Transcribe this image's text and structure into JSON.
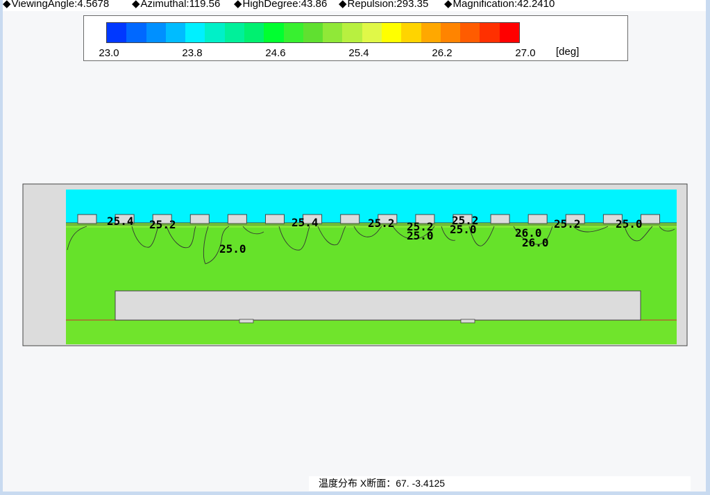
{
  "header": {
    "params": [
      {
        "label": "ViewingAngle",
        "value": ":4.5678"
      },
      {
        "label": "Azimuthal",
        "value": ":119.56"
      },
      {
        "label": "HighDegree",
        "value": ":43.86"
      },
      {
        "label": "Repulsion",
        "value": ":293.35"
      },
      {
        "label": "Magnification",
        "value": ":42.2410"
      }
    ]
  },
  "legend": {
    "ticks": [
      "23.0",
      "23.8",
      "24.6",
      "25.4",
      "26.2",
      "27.0"
    ],
    "unit": "[deg]",
    "colors": [
      "#0038ff",
      "#0068ff",
      "#0090ff",
      "#00bcff",
      "#00f0ff",
      "#00f0c8",
      "#00f09a",
      "#00f070",
      "#00ff30",
      "#38f030",
      "#60e030",
      "#90e838",
      "#b8f040",
      "#e0f848",
      "#ffff00",
      "#ffd400",
      "#ffa800",
      "#ff8400",
      "#ff5c00",
      "#ff3000",
      "#ff0000"
    ]
  },
  "contour_labels": [
    {
      "text": "25.4",
      "id": "c1"
    },
    {
      "text": "25.2",
      "id": "c2"
    },
    {
      "text": "25.0",
      "id": "c3"
    },
    {
      "text": "25.4",
      "id": "c4"
    },
    {
      "text": "25.2",
      "id": "c5"
    },
    {
      "text": "25.2",
      "id": "c6"
    },
    {
      "text": "25.0",
      "id": "c7"
    },
    {
      "text": "25.2",
      "id": "c8"
    },
    {
      "text": "25.0",
      "id": "c9"
    },
    {
      "text": "26.0",
      "id": "c10"
    },
    {
      "text": "26.0",
      "id": "c11"
    },
    {
      "text": "25.2",
      "id": "c12"
    },
    {
      "text": "25.0",
      "id": "c13"
    }
  ],
  "colors": {
    "top_layer": "#00f4ff",
    "field": "#66e22a",
    "field_bottom": "#70e42c",
    "structure": "#dcdcdc",
    "accent_line": "#c05030"
  },
  "footer": {
    "text": "温度分布 X断面：67. -3.4125"
  }
}
